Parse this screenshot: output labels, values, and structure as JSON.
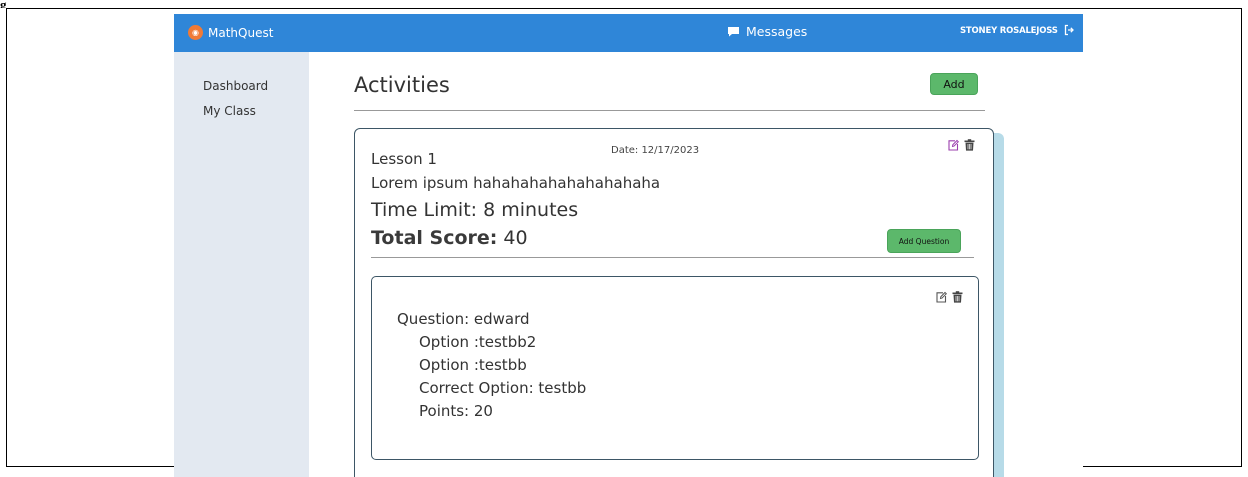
{
  "figure_label": "g",
  "header": {
    "brand": "MathQuest",
    "messages_label": "Messages",
    "user_name": "STONEY ROSALEJOSS"
  },
  "sidebar": {
    "items": [
      {
        "label": "Dashboard"
      },
      {
        "label": "My Class"
      }
    ]
  },
  "main": {
    "title": "Activities",
    "add_label": "Add",
    "activity": {
      "date": "Date: 12/17/2023",
      "lesson": "Lesson 1",
      "description": "Lorem ipsum hahahahahahahahahaha",
      "time_limit": "Time Limit: 8 minutes",
      "score_label": "Total Score:",
      "score_value": " 40",
      "add_question_label": "Add Question",
      "question": {
        "question": "Question: edward",
        "option1": "Option :testbb2",
        "option2": "Option :testbb",
        "correct": "Correct Option: testbb",
        "points": "Points: 20"
      }
    }
  },
  "icons": {
    "brand": "brand-logo-icon",
    "messages": "chat-bubble-icon",
    "logout": "logout-icon",
    "edit": "edit-icon",
    "delete": "trash-icon"
  },
  "colors": {
    "topbar": "#2f86d8",
    "sidebar": "#e3e9f1",
    "button_green": "#5cb86b",
    "card_shadow": "#b7dbe8",
    "card_border": "#3d5666",
    "edit_icon": "#9b3fae"
  }
}
